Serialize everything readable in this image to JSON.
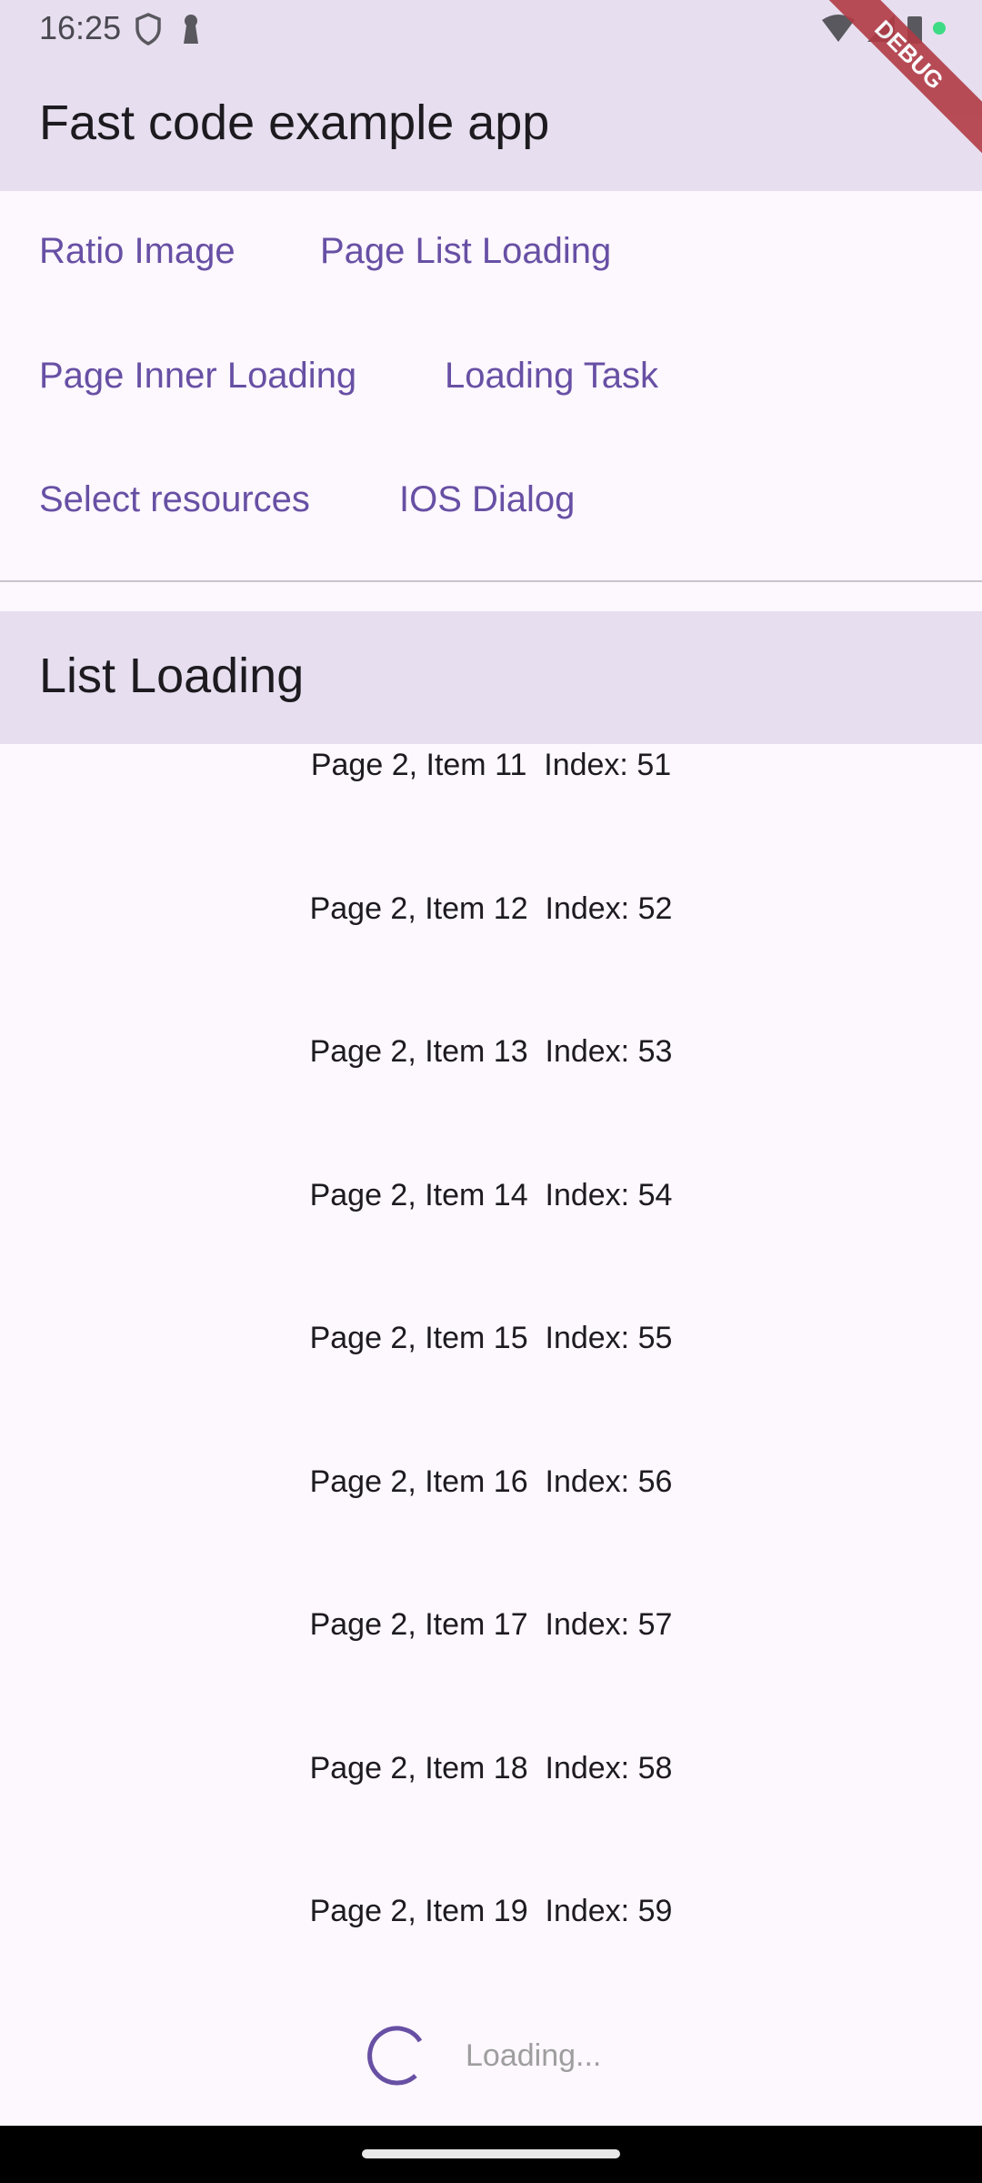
{
  "status_bar": {
    "time": "16:25"
  },
  "app_bar": {
    "title": "Fast code example app"
  },
  "debug_banner": "DEBUG",
  "buttons": [
    "Ratio Image",
    "Page List Loading",
    "Page Inner Loading",
    "Loading Task",
    "Select resources",
    "IOS Dialog"
  ],
  "section": {
    "title": "List Loading"
  },
  "list": {
    "items": [
      "Page 2, Item 11  Index: 51",
      "Page 2, Item 12  Index: 52",
      "Page 2, Item 13  Index: 53",
      "Page 2, Item 14  Index: 54",
      "Page 2, Item 15  Index: 55",
      "Page 2, Item 16  Index: 56",
      "Page 2, Item 17  Index: 57",
      "Page 2, Item 18  Index: 58",
      "Page 2, Item 19  Index: 59"
    ],
    "loading_text": "Loading..."
  },
  "colors": {
    "accent": "#6750a4",
    "app_bar": "#e7dfef",
    "background": "#fdf7fe"
  }
}
